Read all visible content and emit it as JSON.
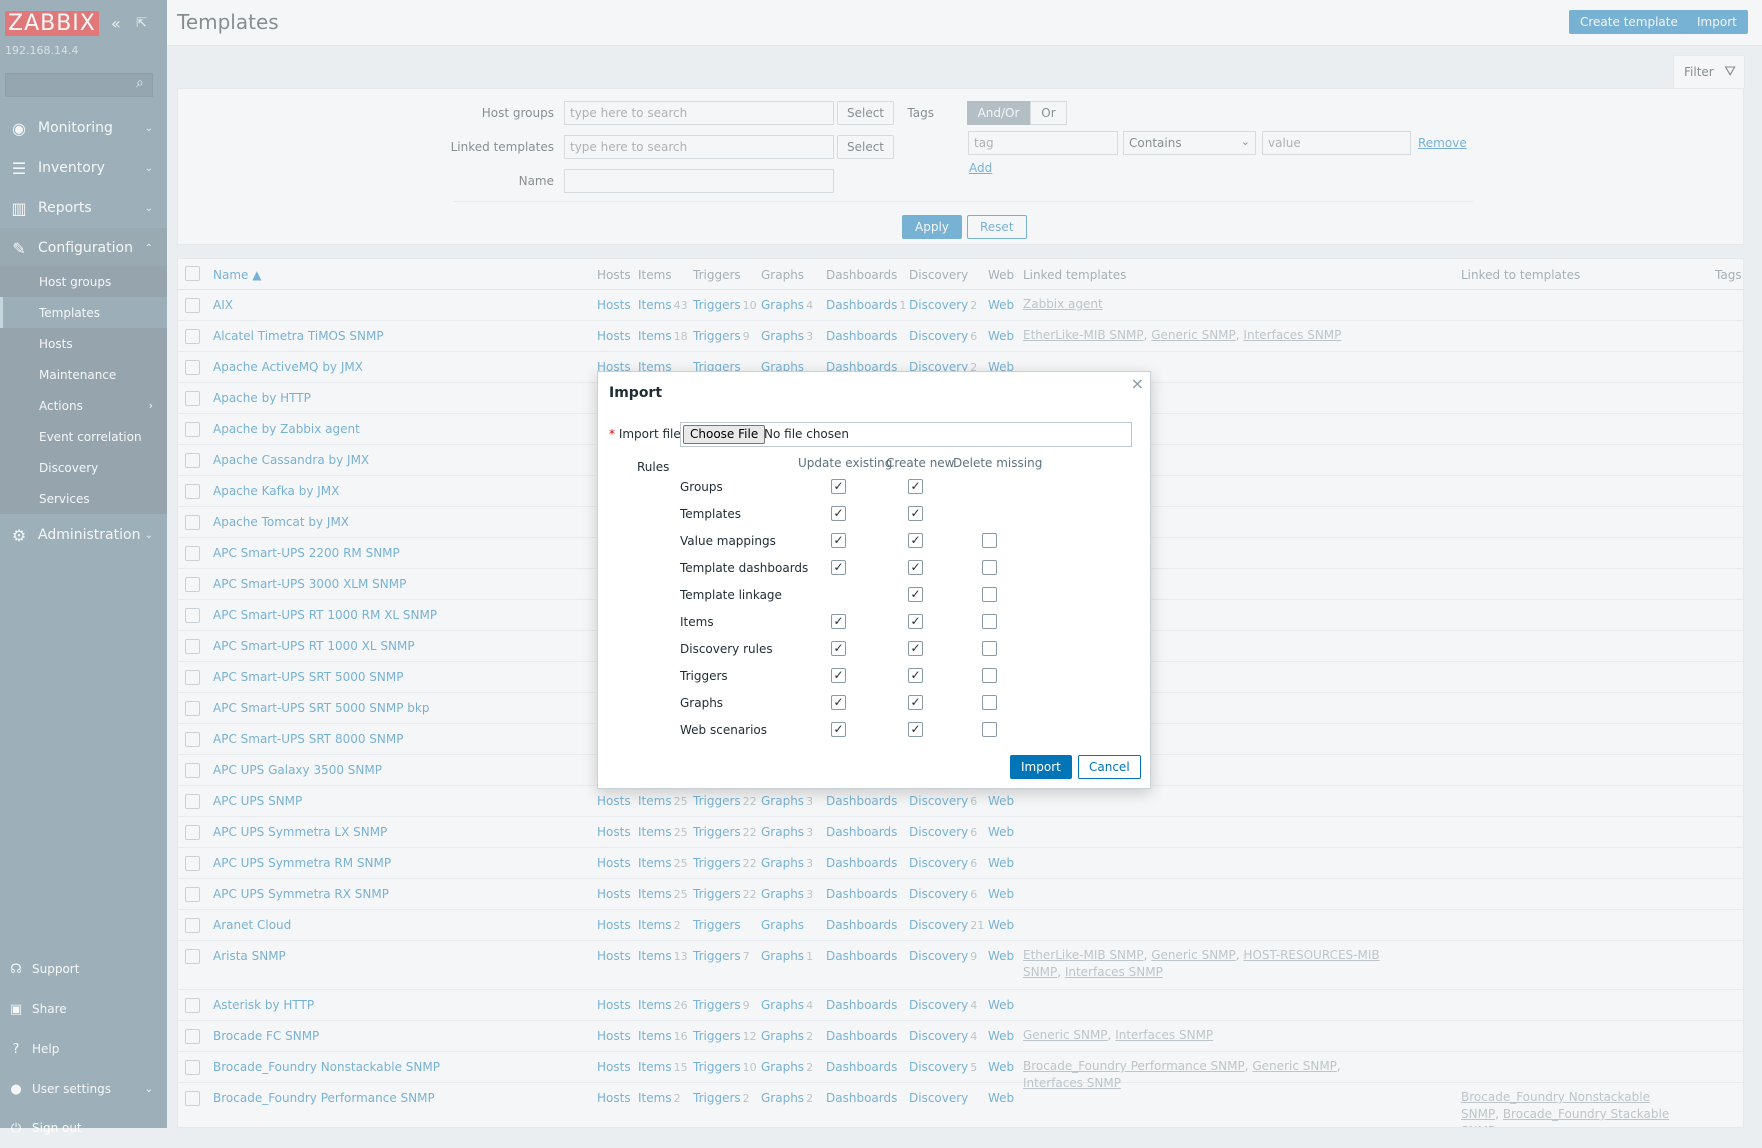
{
  "sidebar": {
    "logo": "ZABBIX",
    "server_ip": "192.168.14.4",
    "search_placeholder": "",
    "menu": [
      {
        "label": "Monitoring",
        "icon": "eye-icon"
      },
      {
        "label": "Inventory",
        "icon": "list-icon"
      },
      {
        "label": "Reports",
        "icon": "chart-icon"
      },
      {
        "label": "Configuration",
        "icon": "wrench-icon"
      }
    ],
    "config_items": [
      "Host groups",
      "Templates",
      "Hosts",
      "Maintenance",
      "Actions",
      "Event correlation",
      "Discovery",
      "Services"
    ],
    "administration": "Administration",
    "bottom": [
      {
        "label": "Support",
        "icon": "headset-icon"
      },
      {
        "label": "Share",
        "icon": "share-icon"
      },
      {
        "label": "Help",
        "icon": "help-icon"
      },
      {
        "label": "User settings",
        "icon": "user-icon"
      },
      {
        "label": "Sign out",
        "icon": "power-icon"
      }
    ]
  },
  "header": {
    "title": "Templates",
    "create_label": "Create template",
    "import_label": "Import"
  },
  "filter": {
    "tab_label": "Filter",
    "host_groups_label": "Host groups",
    "linked_templates_label": "Linked templates",
    "name_label": "Name",
    "search_placeholder": "type here to search",
    "select_label": "Select",
    "tags_label": "Tags",
    "andor_label": "And/Or",
    "or_label": "Or",
    "tag_placeholder": "tag",
    "operator_value": "Contains",
    "value_placeholder": "value",
    "remove_label": "Remove",
    "add_label": "Add",
    "apply_label": "Apply",
    "reset_label": "Reset"
  },
  "table": {
    "columns": {
      "name": "Name ▲",
      "hosts": "Hosts",
      "items": "Items",
      "triggers": "Triggers",
      "graphs": "Graphs",
      "dashboards": "Dashboards",
      "discovery": "Discovery",
      "web": "Web",
      "linked_templates": "Linked templates",
      "linked_to": "Linked to templates",
      "tags": "Tags"
    },
    "rows": [
      {
        "name": "AIX",
        "hosts": "Hosts",
        "items": "Items",
        "items_n": "43",
        "triggers": "Triggers",
        "triggers_n": "10",
        "graphs": "Graphs",
        "graphs_n": "4",
        "dashboards": "Dashboards",
        "dashboards_n": "1",
        "discovery": "Discovery",
        "discovery_n": "2",
        "web": "Web",
        "linked": [
          "Zabbix agent"
        ],
        "linked_to": []
      },
      {
        "name": "Alcatel Timetra TiMOS SNMP",
        "hosts": "Hosts",
        "items": "Items",
        "items_n": "18",
        "triggers": "Triggers",
        "triggers_n": "9",
        "graphs": "Graphs",
        "graphs_n": "3",
        "dashboards": "Dashboards",
        "dashboards_n": "",
        "discovery": "Discovery",
        "discovery_n": "6",
        "web": "Web",
        "linked": [
          "EtherLike-MIB SNMP",
          "Generic SNMP",
          "Interfaces SNMP"
        ],
        "linked_to": []
      },
      {
        "name": "Apache ActiveMQ by JMX",
        "hosts": "Hosts",
        "items": "Items",
        "items_n": "",
        "triggers": "Triggers",
        "triggers_n": "",
        "graphs": "Graphs",
        "graphs_n": "",
        "dashboards": "Dashboards",
        "dashboards_n": "",
        "discovery": "Discovery",
        "discovery_n": "2",
        "web": "Web",
        "linked": [],
        "linked_to": []
      },
      {
        "name": "Apache by HTTP",
        "linked": [],
        "linked_to": []
      },
      {
        "name": "Apache by Zabbix agent",
        "linked": [],
        "linked_to": []
      },
      {
        "name": "Apache Cassandra by JMX",
        "linked": [],
        "linked_to": []
      },
      {
        "name": "Apache Kafka by JMX",
        "linked": [],
        "linked_to": []
      },
      {
        "name": "Apache Tomcat by JMX",
        "linked": [],
        "linked_to": []
      },
      {
        "name": "APC Smart-UPS 2200 RM SNMP",
        "linked": [],
        "linked_to": []
      },
      {
        "name": "APC Smart-UPS 3000 XLM SNMP",
        "linked": [],
        "linked_to": []
      },
      {
        "name": "APC Smart-UPS RT 1000 RM XL SNMP",
        "linked": [],
        "linked_to": []
      },
      {
        "name": "APC Smart-UPS RT 1000 XL SNMP",
        "linked": [],
        "linked_to": []
      },
      {
        "name": "APC Smart-UPS SRT 5000 SNMP",
        "linked": [],
        "linked_to": []
      },
      {
        "name": "APC Smart-UPS SRT 5000 SNMP bkp",
        "linked": [],
        "linked_to": []
      },
      {
        "name": "APC Smart-UPS SRT 8000 SNMP",
        "linked": [],
        "linked_to": []
      },
      {
        "name": "APC UPS Galaxy 3500 SNMP",
        "linked": [],
        "linked_to": []
      },
      {
        "name": "APC UPS SNMP",
        "hosts": "Hosts",
        "items": "Items",
        "items_n": "25",
        "triggers": "Triggers",
        "triggers_n": "22",
        "graphs": "Graphs",
        "graphs_n": "3",
        "dashboards": "Dashboards",
        "dashboards_n": "",
        "discovery": "Discovery",
        "discovery_n": "6",
        "web": "Web",
        "linked": [],
        "linked_to": []
      },
      {
        "name": "APC UPS Symmetra LX SNMP",
        "hosts": "Hosts",
        "items": "Items",
        "items_n": "25",
        "triggers": "Triggers",
        "triggers_n": "22",
        "graphs": "Graphs",
        "graphs_n": "3",
        "dashboards": "Dashboards",
        "dashboards_n": "",
        "discovery": "Discovery",
        "discovery_n": "6",
        "web": "Web",
        "linked": [],
        "linked_to": []
      },
      {
        "name": "APC UPS Symmetra RM SNMP",
        "hosts": "Hosts",
        "items": "Items",
        "items_n": "25",
        "triggers": "Triggers",
        "triggers_n": "22",
        "graphs": "Graphs",
        "graphs_n": "3",
        "dashboards": "Dashboards",
        "dashboards_n": "",
        "discovery": "Discovery",
        "discovery_n": "6",
        "web": "Web",
        "linked": [],
        "linked_to": []
      },
      {
        "name": "APC UPS Symmetra RX SNMP",
        "hosts": "Hosts",
        "items": "Items",
        "items_n": "25",
        "triggers": "Triggers",
        "triggers_n": "22",
        "graphs": "Graphs",
        "graphs_n": "3",
        "dashboards": "Dashboards",
        "dashboards_n": "",
        "discovery": "Discovery",
        "discovery_n": "6",
        "web": "Web",
        "linked": [],
        "linked_to": []
      },
      {
        "name": "Aranet Cloud",
        "hosts": "Hosts",
        "items": "Items",
        "items_n": "2",
        "triggers": "Triggers",
        "triggers_n": "",
        "graphs": "Graphs",
        "graphs_n": "",
        "dashboards": "Dashboards",
        "dashboards_n": "",
        "discovery": "Discovery",
        "discovery_n": "21",
        "web": "Web",
        "linked": [],
        "linked_to": []
      },
      {
        "name": "Arista SNMP",
        "hosts": "Hosts",
        "items": "Items",
        "items_n": "13",
        "triggers": "Triggers",
        "triggers_n": "7",
        "graphs": "Graphs",
        "graphs_n": "1",
        "dashboards": "Dashboards",
        "dashboards_n": "",
        "discovery": "Discovery",
        "discovery_n": "9",
        "web": "Web",
        "linked": [
          "EtherLike-MIB SNMP",
          "Generic SNMP",
          "HOST-RESOURCES-MIB SNMP",
          "Interfaces SNMP"
        ],
        "linked_to": []
      },
      {
        "name": "Asterisk by HTTP",
        "hosts": "Hosts",
        "items": "Items",
        "items_n": "26",
        "triggers": "Triggers",
        "triggers_n": "9",
        "graphs": "Graphs",
        "graphs_n": "4",
        "dashboards": "Dashboards",
        "dashboards_n": "",
        "discovery": "Discovery",
        "discovery_n": "4",
        "web": "Web",
        "linked": [],
        "linked_to": []
      },
      {
        "name": "Brocade FC SNMP",
        "hosts": "Hosts",
        "items": "Items",
        "items_n": "16",
        "triggers": "Triggers",
        "triggers_n": "12",
        "graphs": "Graphs",
        "graphs_n": "2",
        "dashboards": "Dashboards",
        "dashboards_n": "",
        "discovery": "Discovery",
        "discovery_n": "4",
        "web": "Web",
        "linked": [
          "Generic SNMP",
          "Interfaces SNMP"
        ],
        "linked_to": []
      },
      {
        "name": "Brocade_Foundry Nonstackable SNMP",
        "hosts": "Hosts",
        "items": "Items",
        "items_n": "15",
        "triggers": "Triggers",
        "triggers_n": "10",
        "graphs": "Graphs",
        "graphs_n": "2",
        "dashboards": "Dashboards",
        "dashboards_n": "",
        "discovery": "Discovery",
        "discovery_n": "5",
        "web": "Web",
        "linked": [
          "Brocade_Foundry Performance SNMP",
          "Generic SNMP",
          "Interfaces SNMP"
        ],
        "linked_to": []
      },
      {
        "name": "Brocade_Foundry Performance SNMP",
        "hosts": "Hosts",
        "items": "Items",
        "items_n": "2",
        "triggers": "Triggers",
        "triggers_n": "2",
        "graphs": "Graphs",
        "graphs_n": "2",
        "dashboards": "Dashboards",
        "dashboards_n": "",
        "discovery": "Discovery",
        "discovery_n": "",
        "web": "Web",
        "linked": [],
        "linked_to": [
          "Brocade_Foundry Nonstackable SNMP",
          "Brocade_Foundry Stackable SNMP"
        ]
      }
    ]
  },
  "dialog": {
    "title": "Import",
    "import_file_label": "Import file",
    "choose_file_label": "Choose File",
    "no_file_text": "No file chosen",
    "rules_label": "Rules",
    "col_update": "Update existing",
    "col_create": "Create new",
    "col_delete": "Delete missing",
    "rules": [
      {
        "label": "Groups",
        "update": true,
        "create": true,
        "delete": null
      },
      {
        "label": "Templates",
        "update": true,
        "create": true,
        "delete": null
      },
      {
        "label": "Value mappings",
        "update": true,
        "create": true,
        "delete": false
      },
      {
        "label": "Template dashboards",
        "update": true,
        "create": true,
        "delete": false
      },
      {
        "label": "Template linkage",
        "update": null,
        "create": true,
        "delete": false
      },
      {
        "label": "Items",
        "update": true,
        "create": true,
        "delete": false
      },
      {
        "label": "Discovery rules",
        "update": true,
        "create": true,
        "delete": false
      },
      {
        "label": "Triggers",
        "update": true,
        "create": true,
        "delete": false
      },
      {
        "label": "Graphs",
        "update": true,
        "create": true,
        "delete": false
      },
      {
        "label": "Web scenarios",
        "update": true,
        "create": true,
        "delete": false
      }
    ],
    "import_button": "Import",
    "cancel_button": "Cancel"
  }
}
